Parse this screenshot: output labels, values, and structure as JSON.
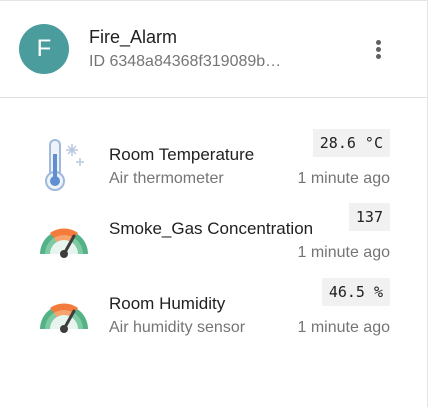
{
  "device": {
    "avatar_letter": "F",
    "name": "Fire_Alarm",
    "id": "ID 6348a84368f319089b…",
    "avatar_color": "#4b9c9c"
  },
  "menu": {
    "icon": "more-vertical-icon"
  },
  "sensors": [
    {
      "title": "Room Temperature",
      "subtitle": "Air thermometer",
      "value": "28.6 °C",
      "time": "1 minute ago",
      "icon": "thermometer-icon"
    },
    {
      "title": "Smoke_Gas Concentration",
      "subtitle": "",
      "value": "137",
      "time": "1 minute ago",
      "icon": "gauge-icon"
    },
    {
      "title": "Room Humidity",
      "subtitle": "Air humidity sensor",
      "value": "46.5 %",
      "time": "1 minute ago",
      "icon": "gauge-icon"
    }
  ],
  "colors": {
    "gauge_green": "#4caf7a",
    "gauge_orange": "#f47b3c",
    "thermo_blue": "#7aa3d8"
  }
}
